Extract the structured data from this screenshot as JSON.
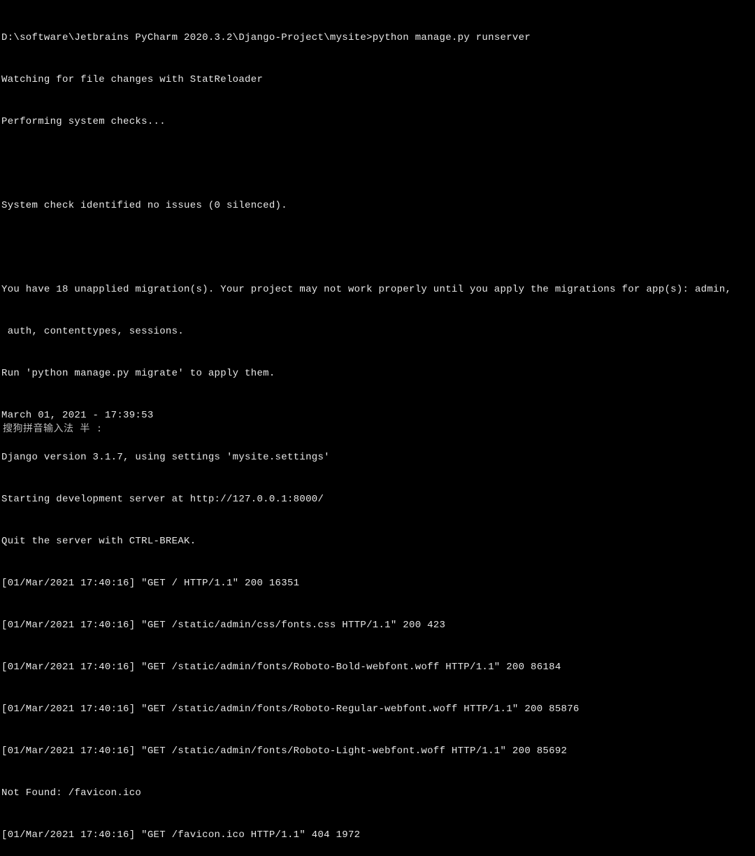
{
  "terminal": {
    "prompt_path": "D:\\software\\Jetbrains PyCharm 2020.3.2\\Django-Project\\mysite>",
    "command": "python manage.py runserver",
    "lines": [
      "Watching for file changes with StatReloader",
      "Performing system checks...",
      "",
      "System check identified no issues (0 silenced).",
      "",
      "You have 18 unapplied migration(s). Your project may not work properly until you apply the migrations for app(s): admin,",
      " auth, contenttypes, sessions.",
      "Run 'python manage.py migrate' to apply them.",
      "March 01, 2021 - 17:39:53",
      "Django version 3.1.7, using settings 'mysite.settings'",
      "Starting development server at http://127.0.0.1:8000/",
      "Quit the server with CTRL-BREAK.",
      "[01/Mar/2021 17:40:16] \"GET / HTTP/1.1\" 200 16351",
      "[01/Mar/2021 17:40:16] \"GET /static/admin/css/fonts.css HTTP/1.1\" 200 423",
      "[01/Mar/2021 17:40:16] \"GET /static/admin/fonts/Roboto-Bold-webfont.woff HTTP/1.1\" 200 86184",
      "[01/Mar/2021 17:40:16] \"GET /static/admin/fonts/Roboto-Regular-webfont.woff HTTP/1.1\" 200 85876",
      "[01/Mar/2021 17:40:16] \"GET /static/admin/fonts/Roboto-Light-webfont.woff HTTP/1.1\" 200 85692",
      "Not Found: /favicon.ico",
      "[01/Mar/2021 17:40:16] \"GET /favicon.ico HTTP/1.1\" 404 1972"
    ]
  },
  "ime": {
    "status_text": "搜狗拼音输入法 半 :"
  }
}
